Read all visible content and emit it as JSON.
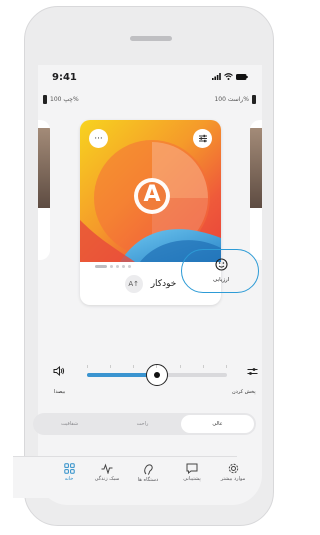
{
  "status": {
    "time": "9:41"
  },
  "batteries": {
    "left": {
      "label": "چپ 100%"
    },
    "right": {
      "label": "راست 100%"
    }
  },
  "program_card": {
    "letter": "A",
    "name": "خودکار",
    "auto_icon": "A↑",
    "more_icon": "···"
  },
  "carousel": {
    "active_index": 0,
    "count": 5
  },
  "rate": {
    "label": "ارزیابی"
  },
  "volume": {
    "mute_label": "بیصدا",
    "adjust_label": "پخش کردن",
    "level": 0.5
  },
  "segments": [
    {
      "label": "شفافیت",
      "selected": false
    },
    {
      "label": "راحت",
      "selected": false
    },
    {
      "label": "عالی",
      "selected": true
    }
  ],
  "tabs": [
    {
      "label": "خانه",
      "icon": "home-grid-icon",
      "active": true
    },
    {
      "label": "سبک زندگی",
      "icon": "activity-icon",
      "active": false
    },
    {
      "label": "دستگاه ها",
      "icon": "hearing-aid-icon",
      "active": false
    },
    {
      "label": "پشتیبانی",
      "icon": "chat-icon",
      "active": false
    },
    {
      "label": "موارد بیشتر",
      "icon": "gear-icon",
      "active": false
    }
  ],
  "colors": {
    "accent": "#2d9bd6",
    "tab_active": "#2d8ec9",
    "slider": "#3a94d0"
  }
}
